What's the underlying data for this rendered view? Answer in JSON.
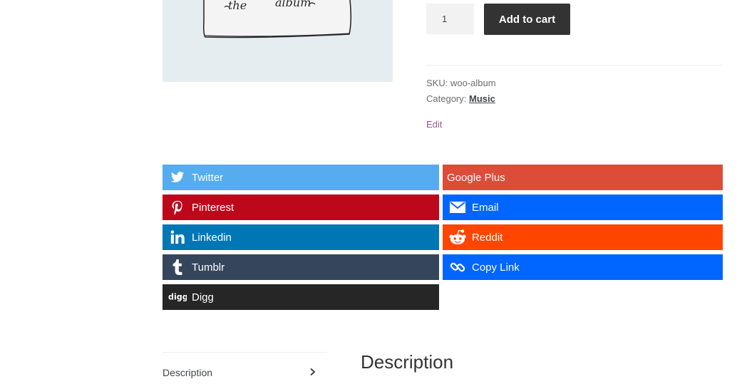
{
  "product": {
    "image_text": [
      "the",
      "album"
    ],
    "quantity": "1",
    "add_to_cart_label": "Add to cart",
    "sku_label": "SKU:",
    "sku_value": "woo-album",
    "category_label": "Category:",
    "category_value": "Music",
    "edit_label": "Edit"
  },
  "share": {
    "buttons": [
      {
        "label": "Twitter",
        "icon": "twitter-icon",
        "color": "#55acee"
      },
      {
        "label": "Google Plus",
        "icon": "",
        "color": "#dd4b39"
      },
      {
        "label": "Pinterest",
        "icon": "pinterest-icon",
        "color": "#bd081c"
      },
      {
        "label": "Email",
        "icon": "envelope-icon",
        "color": "#0166ff"
      },
      {
        "label": "Linkedin",
        "icon": "linkedin-icon",
        "color": "#0077b5"
      },
      {
        "label": "Reddit",
        "icon": "reddit-icon",
        "color": "#ff4500"
      },
      {
        "label": "Tumblr",
        "icon": "tumblr-icon",
        "color": "#35465c"
      },
      {
        "label": "Copy Link",
        "icon": "link-icon",
        "color": "#0166ff"
      },
      {
        "label": "Digg",
        "icon": "digg-icon",
        "color": "#262626"
      }
    ]
  },
  "tabs": {
    "items": [
      {
        "label": "Description"
      }
    ],
    "heading": "Description"
  }
}
